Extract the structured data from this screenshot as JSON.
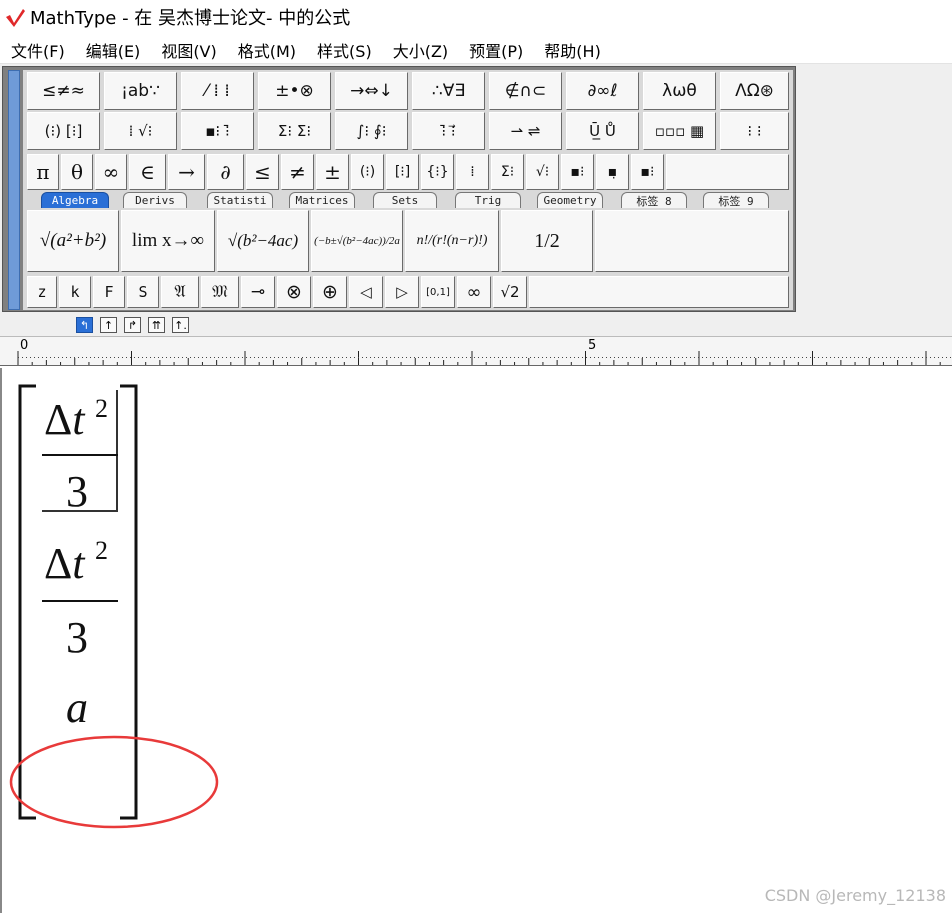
{
  "window": {
    "title": "MathType - 在 吴杰博士论文- 中的公式",
    "logo_icon": "mathtype-logo-icon",
    "logo_color": "#e0282a"
  },
  "menu": {
    "items": [
      "文件(F)",
      "编辑(E)",
      "视图(V)",
      "格式(M)",
      "样式(S)",
      "大小(Z)",
      "预置(P)",
      "帮助(H)"
    ]
  },
  "palette": {
    "row1": [
      "≤≠≈",
      "¡ab∵",
      "⁄ ⁞ ⁞",
      "±•⊗",
      "→⇔↓",
      "∴∀∃",
      "∉∩⊂",
      "∂∞ℓ",
      "λωθ",
      "ΛΩ⊛"
    ],
    "row2": [
      "(⁝) [⁝]",
      "⁞ √⁝",
      "▪⁝ ⁝̄",
      "Σ⁝ Σ⁝",
      "∫⁝ ∮⁝",
      "⁝̄ ⁝⃗",
      "⇀ ⇌",
      "Ū̲ Ů",
      "▫▫▫ ▦",
      "⁝ ⁝"
    ],
    "row3": [
      "π",
      "θ",
      "∞",
      "∈",
      "→",
      "∂",
      "≤",
      "≠",
      "±",
      "(⁝)",
      "[⁝]",
      "{⁝}",
      "⁞",
      "Σ⁝",
      "√⁝",
      "▪⁝",
      "▪̣",
      "▪⁝"
    ],
    "tabs": [
      "Algebra",
      "Derivs",
      "Statisti",
      "Matrices",
      "Sets",
      "Trig",
      "Geometry",
      "标签 8",
      "标签 9"
    ],
    "active_tab": "Algebra",
    "templates": [
      "√(a²+b²)",
      "lim x→∞",
      "√(b²−4ac)",
      "(−b±√(b²−4ac))/2a",
      "n!/(r!(n−r)!)",
      "1/2"
    ],
    "row5": [
      "z",
      "k",
      "F",
      "S",
      "𝔄",
      "𝔐",
      "⊸",
      "⊗",
      "⊕",
      "◁",
      "▷",
      "[0,1]",
      "∞",
      "√2"
    ]
  },
  "alignment_buttons": [
    "↰",
    "↑",
    "↱",
    "⇈",
    "↑."
  ],
  "ruler": {
    "label_0": "0",
    "label_5": "5"
  },
  "equation": {
    "entries": [
      {
        "numerator": "Δt",
        "exponent": "2",
        "denominator": "3"
      },
      {
        "numerator": "Δt",
        "exponent": "2",
        "denominator": "3"
      }
    ],
    "single": "a",
    "bracket": "[ ]",
    "annotation_color": "#e83a3a"
  },
  "watermark": "CSDN @Jeremy_12138"
}
